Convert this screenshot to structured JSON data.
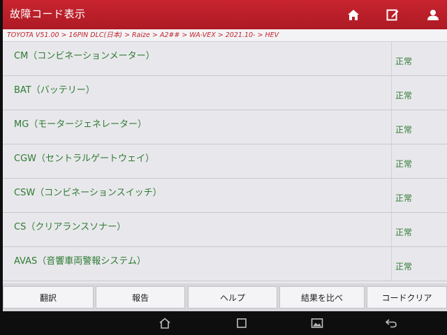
{
  "header": {
    "title": "故障コード表示",
    "icons": [
      "home-icon",
      "edit-report-icon",
      "user-icon"
    ]
  },
  "breadcrumb": "TOYOTA V51.00 > 16PIN DLC(日本) > Raize > A2## > WA-VEX > 2021.10- > HEV",
  "rows": [
    {
      "name": "CM（コンビネーションメーター）",
      "status": "正常"
    },
    {
      "name": "BAT（バッテリー）",
      "status": "正常"
    },
    {
      "name": "MG（モータージェネレーター）",
      "status": "正常"
    },
    {
      "name": "CGW（セントラルゲートウェイ）",
      "status": "正常"
    },
    {
      "name": "CSW（コンビネーションスイッチ）",
      "status": "正常"
    },
    {
      "name": "CS（クリアランスソナー）",
      "status": "正常"
    },
    {
      "name": "AVAS（音響車両警報システム）",
      "status": "正常"
    }
  ],
  "buttons": {
    "translate": "翻訳",
    "report": "報告",
    "help": "ヘルプ",
    "compare": "結果を比べ",
    "clear_codes": "コードクリア"
  },
  "navbar": {
    "icons": [
      "android-home-icon",
      "recents-icon",
      "screenshot-icon",
      "back-icon"
    ]
  },
  "colors": {
    "header_red": "#c0202c",
    "text_green": "#2f7a33",
    "breadcrumb_red": "#c0262f"
  }
}
